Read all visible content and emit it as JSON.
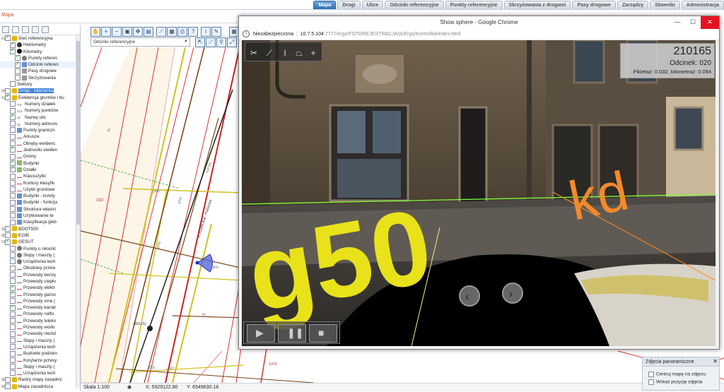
{
  "app": {
    "title": "Mapa",
    "tabs": [
      {
        "label": "Mapa",
        "active": true
      },
      {
        "label": "Drogi",
        "active": false
      },
      {
        "label": "Ulice",
        "active": false
      },
      {
        "label": "Odcinki referencyjne",
        "active": false
      },
      {
        "label": "Punkty referencyjne",
        "active": false
      },
      {
        "label": "Skrzyżowania z drogami",
        "active": false
      },
      {
        "label": "Pasy drogowe",
        "active": false
      },
      {
        "label": "Zarządcy",
        "active": false
      },
      {
        "label": "Słowniki",
        "active": false
      },
      {
        "label": "Administracja",
        "active": false
      }
    ]
  },
  "layers": [
    {
      "label": "Sieć referencyjna",
      "level": 0,
      "checked": true,
      "exp": "⊟",
      "icon": "folder"
    },
    {
      "label": "Hektometry",
      "level": 1,
      "checked": true,
      "exp": "",
      "icon": "hekto"
    },
    {
      "label": "Kilometry",
      "level": 1,
      "checked": true,
      "exp": "",
      "icon": "km"
    },
    {
      "label": "Punkty referen",
      "level": 2,
      "checked": true,
      "exp": "",
      "icon": "dot"
    },
    {
      "label": "Odcinki referen",
      "level": 2,
      "checked": true,
      "exp": "",
      "icon": "multi",
      "selected_row": true
    },
    {
      "label": "Pasy drogowe",
      "level": 2,
      "checked": false,
      "exp": "",
      "icon": "box"
    },
    {
      "label": "Skrzyżowania",
      "level": 2,
      "checked": false,
      "exp": "",
      "icon": "box"
    },
    {
      "label": "Sektory",
      "level": 1,
      "checked": false,
      "exp": "",
      "icon": ""
    },
    {
      "label": "Drogi - zdarzenia",
      "level": 0,
      "checked": false,
      "exp": "⊞",
      "icon": "folder",
      "selected": true
    },
    {
      "label": "Ewidencja gruntów i bu",
      "level": 0,
      "checked": true,
      "exp": "⊟",
      "icon": "folder"
    },
    {
      "label": "Numery działek",
      "level": 1,
      "checked": false,
      "exp": "",
      "icon": "txt",
      "icon_text": "7/2"
    },
    {
      "label": "Numery punktów",
      "level": 1,
      "checked": false,
      "exp": "",
      "icon": "txt",
      "icon_text": "213"
    },
    {
      "label": "Nazwy ulic",
      "level": 1,
      "checked": true,
      "exp": "",
      "icon": "txt",
      "icon_text": "UL"
    },
    {
      "label": "Numery adresov",
      "level": 1,
      "checked": false,
      "exp": "",
      "icon": "txt",
      "icon_text": "31"
    },
    {
      "label": "Punkty graniczn",
      "level": 1,
      "checked": false,
      "exp": "",
      "icon": "multi"
    },
    {
      "label": "Arkusze",
      "level": 1,
      "checked": false,
      "exp": "",
      "icon": "line"
    },
    {
      "label": "Obręby ewidenc",
      "level": 1,
      "checked": false,
      "exp": "",
      "icon": "line"
    },
    {
      "label": "Jednostki ewiden",
      "level": 1,
      "checked": true,
      "exp": "",
      "icon": "line"
    },
    {
      "label": "Gminy",
      "level": 1,
      "checked": false,
      "exp": "",
      "icon": "line"
    },
    {
      "label": "Budynki",
      "level": 1,
      "checked": true,
      "exp": "",
      "icon": "fill"
    },
    {
      "label": "Działki",
      "level": 1,
      "checked": true,
      "exp": "",
      "icon": "fill"
    },
    {
      "label": "Klasoużytki",
      "level": 1,
      "checked": false,
      "exp": "",
      "icon": "line"
    },
    {
      "label": "Kontury klasyfik",
      "level": 1,
      "checked": false,
      "exp": "",
      "icon": "line"
    },
    {
      "label": "Użytki gruntowe",
      "level": 1,
      "checked": false,
      "exp": "",
      "icon": "line"
    },
    {
      "label": "Budynki - kondy",
      "level": 1,
      "checked": false,
      "exp": "",
      "icon": "multi"
    },
    {
      "label": "Budynki - funkcja",
      "level": 1,
      "checked": false,
      "exp": "",
      "icon": "multi"
    },
    {
      "label": "Struktura własnc",
      "level": 1,
      "checked": false,
      "exp": "",
      "icon": "multi"
    },
    {
      "label": "Użytkowanie te",
      "level": 1,
      "checked": false,
      "exp": "",
      "icon": "multi"
    },
    {
      "label": "Klasyfikacja gleb",
      "level": 1,
      "checked": false,
      "exp": "",
      "icon": "multi"
    },
    {
      "label": "BDOT500",
      "level": 0,
      "checked": false,
      "exp": "⊞",
      "icon": "folder"
    },
    {
      "label": "EGIB",
      "level": 0,
      "checked": false,
      "exp": "⊞",
      "icon": "folder"
    },
    {
      "label": "GESUT",
      "level": 0,
      "checked": true,
      "exp": "⊟",
      "icon": "folder"
    },
    {
      "label": "Punkty o określc",
      "level": 1,
      "checked": false,
      "exp": "",
      "icon": "dot"
    },
    {
      "label": "Słupy i maszty (",
      "level": 1,
      "checked": false,
      "exp": "",
      "icon": "dot"
    },
    {
      "label": "Urządzenia tech",
      "level": 1,
      "checked": false,
      "exp": "",
      "icon": "dot"
    },
    {
      "label": "Obudowy przew",
      "level": 1,
      "checked": false,
      "exp": "",
      "icon": "line"
    },
    {
      "label": "Przewody benzy",
      "level": 1,
      "checked": false,
      "exp": "",
      "icon": "line"
    },
    {
      "label": "Przewody ciepło",
      "level": 1,
      "checked": false,
      "exp": "",
      "icon": "line"
    },
    {
      "label": "Przewody elektr",
      "level": 1,
      "checked": true,
      "exp": "",
      "icon": "line"
    },
    {
      "label": "Przewody gazov",
      "level": 1,
      "checked": true,
      "exp": "",
      "icon": "line"
    },
    {
      "label": "Przewody inne (",
      "level": 1,
      "checked": false,
      "exp": "",
      "icon": "line"
    },
    {
      "label": "Przewody kanali",
      "level": 1,
      "checked": true,
      "exp": "",
      "icon": "line"
    },
    {
      "label": "Przewody nafto",
      "level": 1,
      "checked": false,
      "exp": "",
      "icon": "line"
    },
    {
      "label": "Przewody teleko",
      "level": 1,
      "checked": false,
      "exp": "",
      "icon": "line"
    },
    {
      "label": "Przewody wodo",
      "level": 1,
      "checked": false,
      "exp": "",
      "icon": "line"
    },
    {
      "label": "Przewody niezid",
      "level": 1,
      "checked": false,
      "exp": "",
      "icon": "line"
    },
    {
      "label": "Słupy i maszty (",
      "level": 1,
      "checked": false,
      "exp": "",
      "icon": "line"
    },
    {
      "label": "Urządzenia tech",
      "level": 1,
      "checked": false,
      "exp": "",
      "icon": "line"
    },
    {
      "label": "Budowle podzien",
      "level": 1,
      "checked": false,
      "exp": "",
      "icon": "line"
    },
    {
      "label": "Korytarze przesy",
      "level": 1,
      "checked": false,
      "exp": "",
      "icon": "line"
    },
    {
      "label": "Słupy i maszty (",
      "level": 1,
      "checked": false,
      "exp": "",
      "icon": "line"
    },
    {
      "label": "Urządzenia tech",
      "level": 1,
      "checked": false,
      "exp": "",
      "icon": "line"
    },
    {
      "label": "Rastry mapy zasadnic",
      "level": 0,
      "checked": false,
      "exp": "⊞",
      "icon": "folder"
    },
    {
      "label": "Mapa zasadnicza",
      "level": 0,
      "checked": false,
      "exp": "⊞",
      "icon": "folder"
    }
  ],
  "map": {
    "layer_select": "Odcinki referencyjne",
    "labels": [
      "1b3",
      "g50c",
      "g50c",
      "g50c",
      "g50c",
      "g50c",
      "kd150c",
      "kd150c",
      "kdBc",
      "kk",
      "kk",
      "1m3",
      "1b3",
      "00(1+5)",
      "G.2018/6.806 - Piekarska"
    ],
    "status": {
      "scale": "Skala 1:100",
      "x": "X: 5929122.80",
      "y": "Y: 6549630.18"
    }
  },
  "popup": {
    "title": "Show sphere - Google Chrome",
    "security": "Niezabezpieczona",
    "url_host": "10.7.5.104",
    "url_path": ":7777/ergo/FOTOREJESTRACJA/js/Ergo/Kontrolka/index.html",
    "info": {
      "id": "210165",
      "segment": "Odcinek: 020",
      "km": "Pikietaż: 0.032, kilometraż: 0.094"
    },
    "overlay_text_1": "g50",
    "overlay_text_2": "kd"
  },
  "pano_panel": {
    "title": "Zdjęcia panoramiczne",
    "opt1": "Centruj mapę na zdjęciu",
    "opt2": "Wskaż pozycję zdjęcia"
  }
}
